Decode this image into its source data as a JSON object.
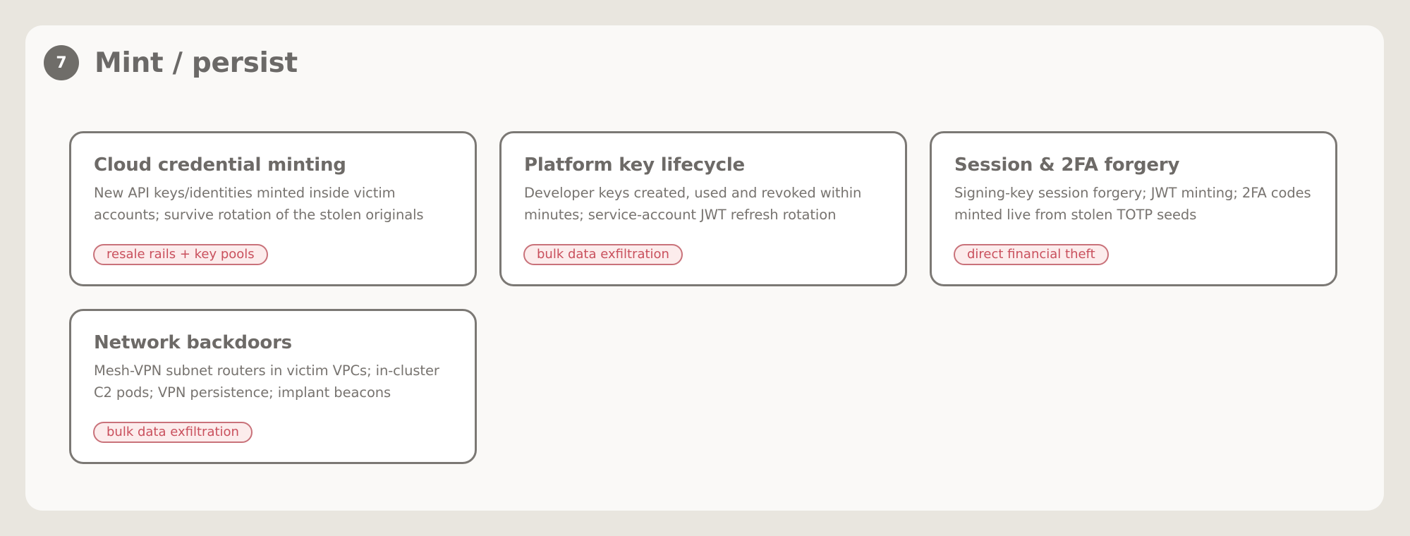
{
  "section": {
    "number": "7",
    "title": "Mint / persist"
  },
  "cards": [
    {
      "title": "Cloud credential minting",
      "description": "New API keys/identities minted inside victim accounts; survive rotation of the stolen originals",
      "tag": "resale rails + key pools"
    },
    {
      "title": "Platform key lifecycle",
      "description": "Developer keys created, used and revoked within minutes; service-account JWT refresh rotation",
      "tag": "bulk data exfiltration"
    },
    {
      "title": "Session & 2FA forgery",
      "description": "Signing-key session forgery; JWT minting; 2FA codes minted live from stolen TOTP seeds",
      "tag": "direct financial theft"
    },
    {
      "title": "Network backdoors",
      "description": "Mesh-VPN subnet routers in victim VPCs; in-cluster C2 pods; VPN persistence; implant beacons",
      "tag": "bulk data exfiltration"
    }
  ],
  "colors": {
    "badge": "#6f6d69",
    "card_border": "#7b7874",
    "tag_text": "#c9505d",
    "tag_border": "#c9727a",
    "tag_fill": "#fcecec"
  }
}
